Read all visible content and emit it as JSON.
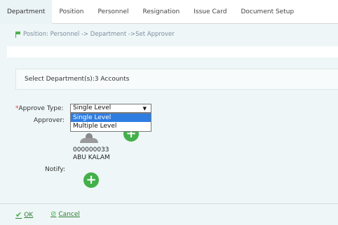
{
  "tabs": [
    "Department",
    "Position",
    "Personnel",
    "Resignation",
    "Issue Card",
    "Document Setup"
  ],
  "breadcrumb": "Position: Personnel -> Department ->Set Approver",
  "select_department": "Select Department(s):3 Accounts",
  "form": {
    "approve_type_required": "*",
    "approve_type_label": "Approve Type:",
    "approve_type_value": "Single Level",
    "approve_type_options": [
      "Single Level",
      "Multiple Level"
    ],
    "approver_label": "Approver:",
    "approver": {
      "code": "000000033",
      "name": "ABU KALAM"
    },
    "notify_label": "Notify:",
    "add_symbol": "+"
  },
  "footer": {
    "ok_label": "OK",
    "cancel_label": "Cancel"
  },
  "colors": {
    "accent_green": "#43b049",
    "selected_option": "#2f7de1",
    "panel_bg": "#eef6f7"
  },
  "icons": [
    "flag-icon",
    "caret-down-icon",
    "add-icon",
    "person-icon",
    "check-icon",
    "cancel-icon"
  ]
}
